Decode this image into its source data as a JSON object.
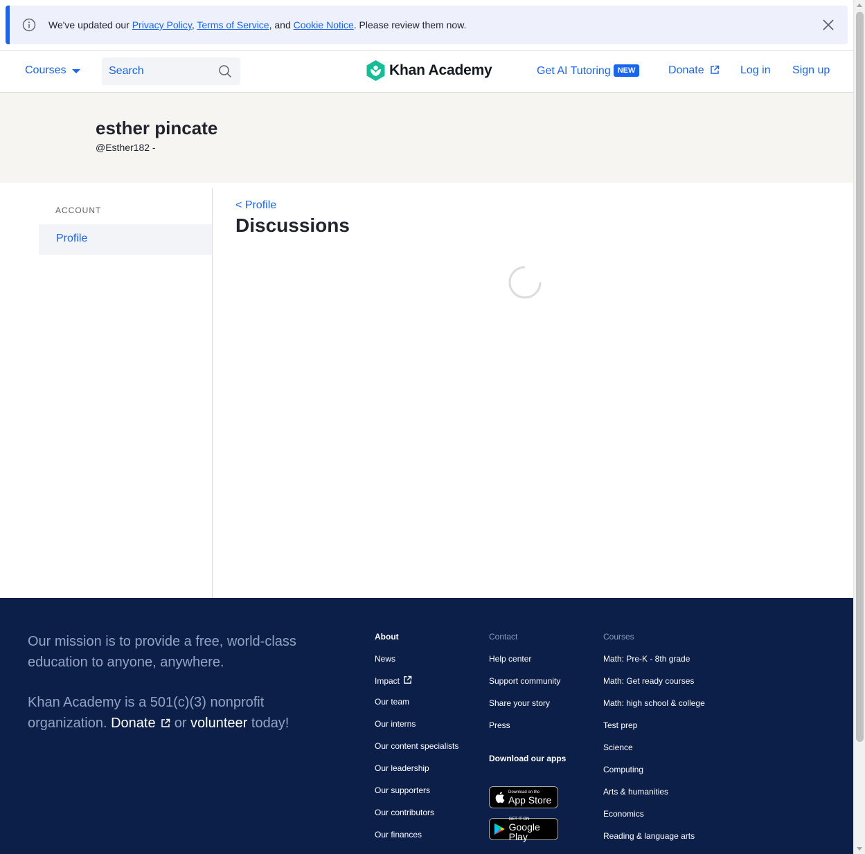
{
  "banner": {
    "prefix": "We've updated our ",
    "privacy_link": "Privacy Policy",
    "comma": ", ",
    "terms_link": "Terms of Service",
    "and": ", and ",
    "cookie_link": "Cookie Notice",
    "suffix": ". Please review them now."
  },
  "header": {
    "courses_label": "Courses",
    "search_label": "Search",
    "logo_text": "Khan Academy",
    "ai_tutoring": "Get AI Tutoring",
    "new_badge": "NEW",
    "donate": "Donate",
    "login": "Log in",
    "signup": "Sign up"
  },
  "profile": {
    "name": "esther pincate",
    "handle": "@Esther182 -"
  },
  "sidebar": {
    "section_label": "ACCOUNT",
    "items": [
      {
        "label": "Profile"
      }
    ]
  },
  "main": {
    "back_link": "< Profile",
    "title": "Discussions"
  },
  "footer": {
    "mission": "Our mission is to provide a free, world-class education to anyone, anywhere.",
    "nonprofit_prefix": "Khan Academy is a 501(c)(3) nonprofit organization. ",
    "donate": "Donate",
    "or": " or ",
    "volunteer": "volunteer",
    "today": " today!",
    "about": {
      "header": "About",
      "links": [
        "News",
        "Impact",
        "Our team",
        "Our interns",
        "Our content specialists",
        "Our leadership",
        "Our supporters",
        "Our contributors",
        "Our finances"
      ]
    },
    "contact": {
      "header": "Contact",
      "links": [
        "Help center",
        "Support community",
        "Share your story",
        "Press"
      ]
    },
    "apps": {
      "header": "Download our apps",
      "app_store_small": "Download on the",
      "app_store_big": "App Store",
      "google_small": "GET IT ON",
      "google_big": "Google Play"
    },
    "courses": {
      "header": "Courses",
      "links": [
        "Math: Pre-K - 8th grade",
        "Math: Get ready courses",
        "Math: high school & college",
        "Test prep",
        "Science",
        "Computing",
        "Arts & humanities",
        "Economics",
        "Reading & language arts"
      ]
    }
  },
  "colors": {
    "brand_blue": "#1865f2",
    "footer_bg": "#0b1f48",
    "logo_green": "#14bf96"
  }
}
